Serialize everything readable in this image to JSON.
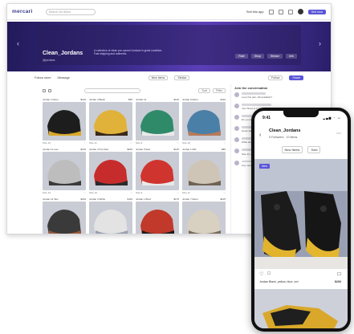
{
  "topbar": {
    "logo": "mercari",
    "search_placeholder": "Search for items",
    "sell_link": "Sell this app",
    "sign_button": "Sell now"
  },
  "banner": {
    "store_name": "Clean_Jordans",
    "store_sub": "@jordans",
    "description": "A collection of clean pre-owned Jordans in great condition. Fast shipping and authentic.",
    "tabs": [
      "Rate",
      "Shop",
      "Stream",
      "Info"
    ]
  },
  "toolbar": {
    "left": [
      "Follow store",
      "Message"
    ],
    "center": [
      "New items",
      "Similar"
    ],
    "right_btn": "Follow",
    "primary_btn": "Share"
  },
  "filter": {
    "sort_label": "Sort",
    "filter_label": "Filter"
  },
  "grid": [
    {
      "title": "Jordan 1 Retro",
      "price": "$120",
      "foot": "Size 10",
      "c1": "#1d1d1d",
      "c2": "#d9a92a"
    },
    {
      "title": "Jordan 4 Black",
      "price": "$95",
      "foot": "Size 11",
      "c1": "#e0b23a",
      "c2": "#3a2a1a"
    },
    {
      "title": "Jordan 13",
      "price": "$140",
      "foot": "Size 9",
      "c1": "#2f8a6a",
      "c2": "#e9e9e9"
    },
    {
      "title": "Jordan 6 Retro",
      "price": "$110",
      "foot": "Size 10",
      "c1": "#4a7fa8",
      "c2": "#b87a5a"
    },
    {
      "title": "Jordan 11 Low",
      "price": "$130",
      "foot": "Size 12",
      "c1": "#bdbdbd",
      "c2": "#3a3a3a"
    },
    {
      "title": "Jordan 3 Fire Red",
      "price": "$150",
      "foot": "Size 10",
      "c1": "#c72c2c",
      "c2": "#2a2a2a"
    },
    {
      "title": "Jordan 5 Red",
      "price": "$125",
      "foot": "Size 9",
      "c1": "#d0342f",
      "c2": "#e8e8e8"
    },
    {
      "title": "Jordan 1 Mid",
      "price": "$85",
      "foot": "Size 11",
      "c1": "#cfc5b6",
      "c2": "#6f6354"
    },
    {
      "title": "Jordan 12 Taxi",
      "price": "$160",
      "foot": "Size 10",
      "c1": "#3a3a3a",
      "c2": "#9a5a3a"
    },
    {
      "title": "Jordan 4 White",
      "price": "$115",
      "foot": "Size 9",
      "c1": "#e3e3e3",
      "c2": "#9aa0b0"
    },
    {
      "title": "Jordan 1 Bred",
      "price": "$175",
      "foot": "Size 10",
      "c1": "#c0392b",
      "c2": "#1d1d1d"
    },
    {
      "title": "Jordan 7 Retro",
      "price": "$105",
      "foot": "Size 8",
      "c1": "#d8d0c0",
      "c2": "#7a6a5a"
    }
  ],
  "side": {
    "title": "Join the conversation",
    "messages": [
      "Love this pair, still available?",
      "Yes! Ships in 1 day.",
      "Do you take offers?",
      "Great seller, fast shipping.",
      "What size is the 4 Black?",
      "Size 11, box included.",
      "Any more 1s coming soon?"
    ]
  },
  "phone": {
    "time": "9:41",
    "status_icons": "▂▄▆ ◔ ▭",
    "store_name": "Clean_Jordans",
    "store_meta": "5 Followers · 10 Items",
    "tabs": [
      "New Items",
      "Sold"
    ],
    "badge": "New",
    "caption": "Jordan Black, yellow, blue, red",
    "price": "$200"
  },
  "colors": {
    "accent": "#5a55d8",
    "banner": "#3a2b8a"
  }
}
